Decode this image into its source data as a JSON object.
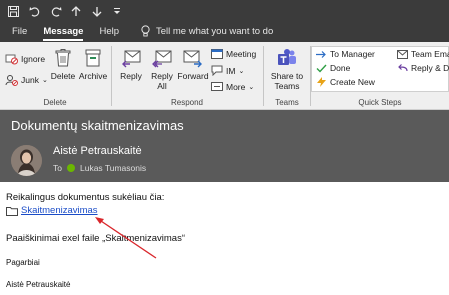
{
  "qat": {
    "icons": [
      "save-icon",
      "undo-icon",
      "redo-icon",
      "up-arrow-icon",
      "down-arrow-icon",
      "customize-icon"
    ]
  },
  "tabs": {
    "items": [
      {
        "label": "File"
      },
      {
        "label": "Message"
      },
      {
        "label": "Help"
      }
    ],
    "active": "Message",
    "tell_me": "Tell me what you want to do"
  },
  "ribbon": {
    "delete_group": {
      "label": "Delete",
      "ignore": "Ignore",
      "junk": "Junk",
      "delete": "Delete",
      "archive": "Archive"
    },
    "respond_group": {
      "label": "Respond",
      "reply": "Reply",
      "reply_all_line1": "Reply",
      "reply_all_line2": "All",
      "forward": "Forward",
      "meeting": "Meeting",
      "im": "IM",
      "more": "More"
    },
    "teams_group": {
      "label": "Teams",
      "share_line1": "Share to",
      "share_line2": "Teams"
    },
    "quick_steps_group": {
      "label": "Quick Steps",
      "to_manager": "To Manager",
      "done": "Done",
      "create_new": "Create New",
      "team_email": "Team Email",
      "reply_delete": "Reply & De"
    }
  },
  "message": {
    "subject": "Dokumentų skaitmenizavimas",
    "sender": "Aistė Petrauskaitė",
    "to_label": "To",
    "recipient": "Lukas Tumasonis",
    "body": {
      "line1": "Reikalingus dokumentus sukėliau čia:",
      "link": "Skaitmenizavimas",
      "line3": "Paaiškinimai exel faile „Skaitmenizavimas“",
      "greeting": "Pagarbiai",
      "signature": "Aistė Petrauskaitė"
    }
  },
  "colors": {
    "title_bar": "#3b3b3b",
    "header_bg": "#5a5a5a",
    "ribbon_bg": "#efefef",
    "link": "#1a4cc7",
    "arrow": "#d9262b",
    "presence": "#6bb700",
    "accent_blue": "#2b6cc4"
  }
}
